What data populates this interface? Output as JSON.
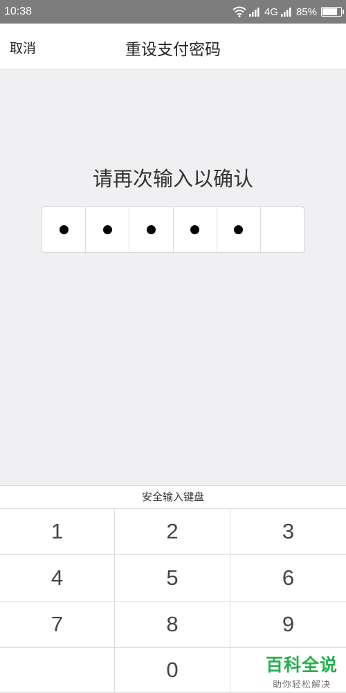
{
  "status_bar": {
    "time": "10:38",
    "network": "4G",
    "battery": "85%",
    "battery_level": 0.85
  },
  "nav": {
    "cancel": "取消",
    "title": "重设支付密码"
  },
  "prompt": "请再次输入以确认",
  "pin": {
    "length": 6,
    "filled": 5
  },
  "keyboard": {
    "title": "安全输入键盘",
    "keys": [
      "1",
      "2",
      "3",
      "4",
      "5",
      "6",
      "7",
      "8",
      "9",
      "",
      "0",
      ""
    ]
  },
  "watermark": {
    "title": "百科全说",
    "subtitle": "助你轻松解决"
  }
}
